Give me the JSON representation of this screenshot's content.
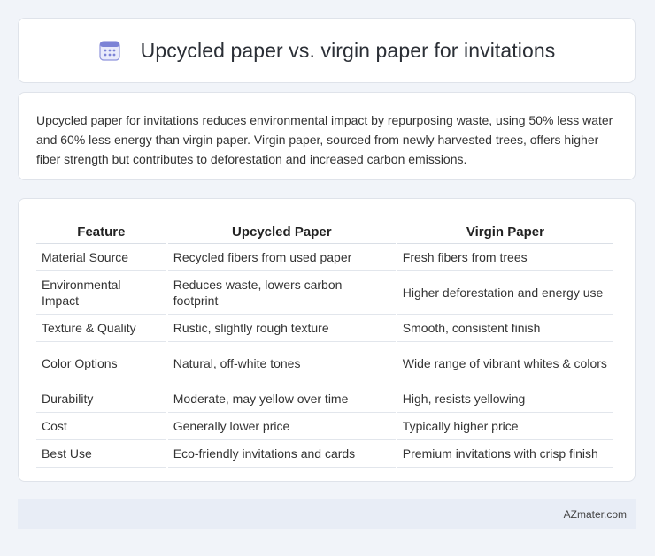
{
  "header": {
    "title": "Upcycled paper vs. virgin paper for invitations",
    "icon": "calendar-icon"
  },
  "summary": "Upcycled paper for invitations reduces environmental impact by repurposing waste, using 50% less water and 60% less energy than virgin paper. Virgin paper, sourced from newly harvested trees, offers higher fiber strength but contributes to deforestation and increased carbon emissions.",
  "table": {
    "headers": [
      "Feature",
      "Upcycled Paper",
      "Virgin Paper"
    ],
    "rows": [
      [
        "Material Source",
        "Recycled fibers from used paper",
        "Fresh fibers from trees"
      ],
      [
        "Environmental Impact",
        "Reduces waste, lowers carbon footprint",
        "Higher deforestation and energy use"
      ],
      [
        "Texture & Quality",
        "Rustic, slightly rough texture",
        "Smooth, consistent finish"
      ],
      [
        "Color Options",
        "Natural, off-white tones",
        "Wide range of vibrant whites & colors"
      ],
      [
        "Durability",
        "Moderate, may yellow over time",
        "High, resists yellowing"
      ],
      [
        "Cost",
        "Generally lower price",
        "Typically higher price"
      ],
      [
        "Best Use",
        "Eco-friendly invitations and cards",
        "Premium invitations with crisp finish"
      ]
    ]
  },
  "footer": {
    "site": "AZmater.com"
  },
  "colors": {
    "background": "#f1f4f9",
    "card": "#ffffff",
    "footer": "#e8edf6",
    "icon_accent": "#7c83d6"
  }
}
